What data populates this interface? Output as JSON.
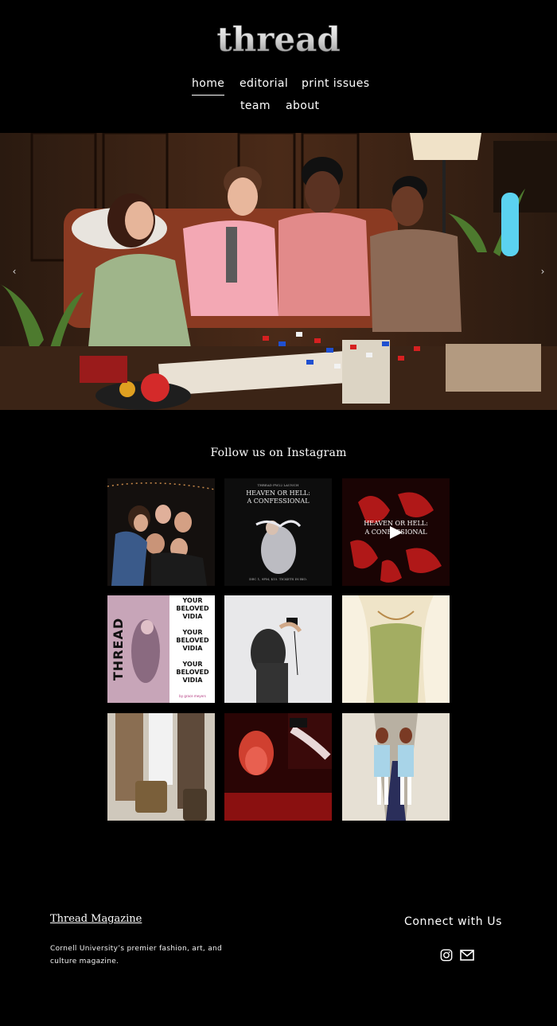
{
  "header": {
    "logo_text": "thread",
    "nav": [
      {
        "label": "home",
        "active": true
      },
      {
        "label": "editorial",
        "active": false
      },
      {
        "label": "print issues",
        "active": false
      },
      {
        "label": "team",
        "active": false
      },
      {
        "label": "about",
        "active": false
      }
    ]
  },
  "hero": {
    "prev_arrow": "‹",
    "next_arrow": "›"
  },
  "instagram": {
    "title": "Follow us on Instagram",
    "posts": [
      {
        "type": "photo",
        "caption_lines": []
      },
      {
        "type": "poster",
        "caption_lines": [
          "THREAD FW22 LAUNCH",
          "HEAVEN OR HELL:",
          "A CONFESSIONAL",
          "DEC 1, 9PM, $15. TICKETS IN BIO."
        ]
      },
      {
        "type": "video",
        "caption_lines": [
          "HEAVEN OR HELL:",
          "A CONFESSIONAL"
        ]
      },
      {
        "type": "poster",
        "caption_lines": [
          "THREAD",
          "YOUR BELOVED VIDIA",
          "by grace meyers"
        ]
      },
      {
        "type": "photo",
        "caption_lines": []
      },
      {
        "type": "photo",
        "caption_lines": []
      },
      {
        "type": "photo",
        "caption_lines": []
      },
      {
        "type": "photo",
        "caption_lines": []
      },
      {
        "type": "photo",
        "caption_lines": []
      }
    ]
  },
  "footer": {
    "site_title": "Thread Magazine",
    "description": "Cornell University’s premier fashion, art, and culture magazine.",
    "connect_heading": "Connect with Us",
    "social": [
      "instagram-icon",
      "email-icon"
    ]
  },
  "colors": {
    "background": "#000000",
    "text": "#ffffff"
  }
}
